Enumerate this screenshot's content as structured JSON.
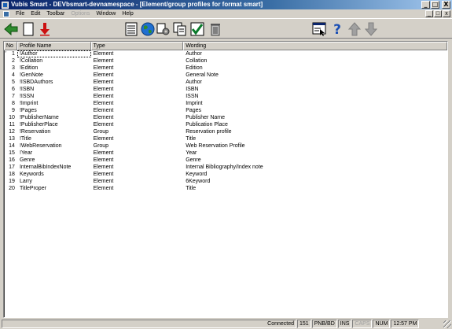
{
  "window": {
    "title": "Vubis Smart - DEVbsmart-devnamespace - [Element/group profiles for format smart]",
    "controls": [
      "_",
      "□",
      "X"
    ]
  },
  "menubar": {
    "items": [
      {
        "label": "File",
        "enabled": true
      },
      {
        "label": "Edit",
        "enabled": true
      },
      {
        "label": "Toolbar",
        "enabled": true
      },
      {
        "label": "Options",
        "enabled": false
      },
      {
        "label": "Window",
        "enabled": true
      },
      {
        "label": "Help",
        "enabled": true
      }
    ],
    "mdi_controls": [
      "_",
      "□",
      "x"
    ]
  },
  "toolbar": {
    "icons": [
      "back-arrow-icon",
      "new-document-icon",
      "delete-red-arrow-icon",
      "details-list-icon",
      "globe-icon",
      "settings-gear-icon",
      "copy-icon",
      "checkmark-icon",
      "trash-bin-icon",
      "select-window-icon",
      "help-icon",
      "move-up-icon",
      "move-down-icon"
    ],
    "colors": {
      "green": "#2e8b2e",
      "red": "#cc1010",
      "help_blue": "#1a4fb4"
    }
  },
  "list": {
    "columns": [
      "No",
      "Profile Name",
      "Type",
      "Wording"
    ],
    "rows": [
      {
        "no": "1",
        "name": "!Author",
        "type": "Element",
        "wording": "Author"
      },
      {
        "no": "2",
        "name": "!Collation",
        "type": "Element",
        "wording": "Collation"
      },
      {
        "no": "3",
        "name": "!Edition",
        "type": "Element",
        "wording": "Edition"
      },
      {
        "no": "4",
        "name": "!GenNote",
        "type": "Element",
        "wording": "General Note"
      },
      {
        "no": "5",
        "name": "!ISBDAuthors",
        "type": "Element",
        "wording": "Author"
      },
      {
        "no": "6",
        "name": "!ISBN",
        "type": "Element",
        "wording": "ISBN"
      },
      {
        "no": "7",
        "name": "!ISSN",
        "type": "Element",
        "wording": "ISSN"
      },
      {
        "no": "8",
        "name": "!Imprint",
        "type": "Element",
        "wording": "Imprint"
      },
      {
        "no": "9",
        "name": "!Pages",
        "type": "Element",
        "wording": "Pages"
      },
      {
        "no": "10",
        "name": "!PublisherName",
        "type": "Element",
        "wording": "Publisher Name"
      },
      {
        "no": "11",
        "name": "!PublisherPlace",
        "type": "Element",
        "wording": "Publication Place"
      },
      {
        "no": "12",
        "name": "!Reservation",
        "type": "Group",
        "wording": "Reservation profile"
      },
      {
        "no": "13",
        "name": "!Title",
        "type": "Element",
        "wording": "Title"
      },
      {
        "no": "14",
        "name": "!WebReservation",
        "type": "Group",
        "wording": "Web Reservation Profile"
      },
      {
        "no": "15",
        "name": "!Year",
        "type": "Element",
        "wording": "Year"
      },
      {
        "no": "16",
        "name": "Genre",
        "type": "Element",
        "wording": "Genre"
      },
      {
        "no": "17",
        "name": "InternalBibIndexNote",
        "type": "Element",
        "wording": "Internal Bibliography/Index note"
      },
      {
        "no": "18",
        "name": "Keywords",
        "type": "Element",
        "wording": "Keyword"
      },
      {
        "no": "19",
        "name": "Larry",
        "type": "Element",
        "wording": "6Keyword"
      },
      {
        "no": "20",
        "name": "TitleProper",
        "type": "Element",
        "wording": "Title"
      }
    ],
    "current_marker": "*"
  },
  "statusbar": {
    "message": "Connected",
    "count": "151",
    "database": "PNB/BD",
    "ins": "INS",
    "caps": "CAPS",
    "num": "NUM",
    "time": "12:57 PM"
  }
}
